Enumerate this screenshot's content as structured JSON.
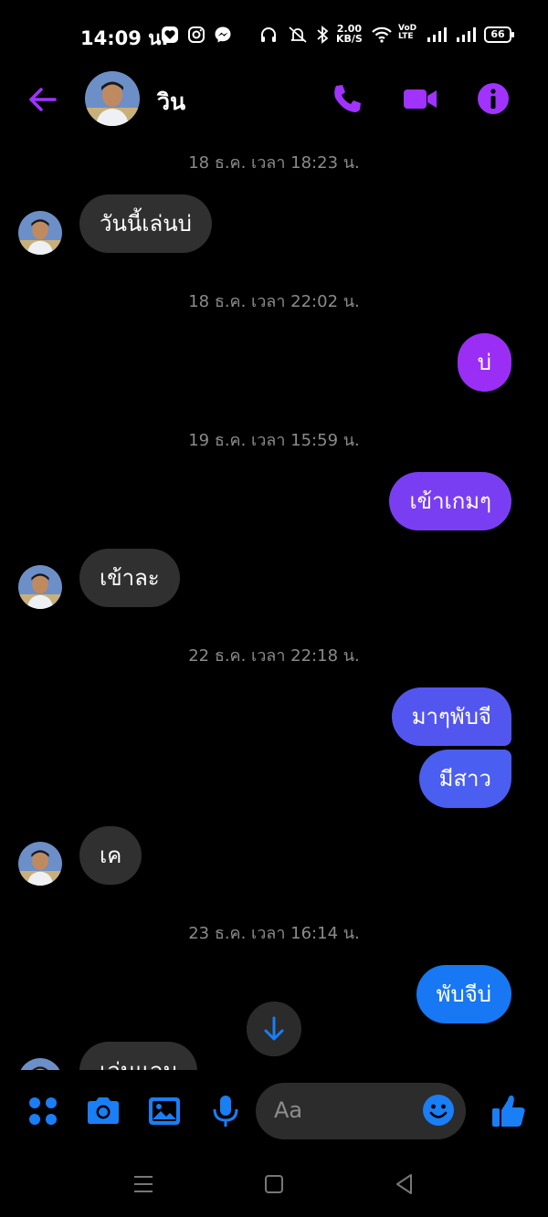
{
  "status": {
    "time": "14:09 น.",
    "speed_value": "2.00",
    "speed_unit": "KB/S",
    "volte_top": "VoD",
    "volte_bottom": "LTE",
    "battery": "66"
  },
  "header": {
    "contact_name": "วิน",
    "accent_color": "#a033ff"
  },
  "messages": [
    {
      "type": "timestamp",
      "text": "18 ธ.ค. เวลา 18:23 น."
    },
    {
      "type": "incoming",
      "text": "วันนี้เล่นบ่"
    },
    {
      "type": "timestamp",
      "text": "18 ธ.ค. เวลา 22:02 น."
    },
    {
      "type": "outgoing",
      "text": "บ่",
      "color": "#9a2ef5"
    },
    {
      "type": "timestamp",
      "text": "19 ธ.ค. เวลา 15:59 น."
    },
    {
      "type": "outgoing",
      "text": "เข้าเกมๆ",
      "color": "#7a3ef2"
    },
    {
      "type": "incoming",
      "text": "เข้าละ"
    },
    {
      "type": "timestamp",
      "text": "22 ธ.ค. เวลา 22:18 น."
    },
    {
      "type": "outgoing",
      "text": "มาๆพับจี",
      "color": "#5356ee"
    },
    {
      "type": "outgoing",
      "text": "มีสาว",
      "color": "#4a5ef0"
    },
    {
      "type": "incoming",
      "text": "เค"
    },
    {
      "type": "timestamp",
      "text": "23 ธ.ค. เวลา 16:14 น."
    },
    {
      "type": "outgoing",
      "text": "พับจีบ่",
      "color": "#1877f2"
    },
    {
      "type": "incoming",
      "text": "เล่นแลม"
    }
  ],
  "composer": {
    "placeholder": "Aa",
    "icon_color": "#1a7ef5"
  },
  "icons": {
    "back": "arrow-left-icon",
    "call": "phone-icon",
    "video": "video-camera-icon",
    "info": "info-icon",
    "apps": "four-dots-icon",
    "camera": "camera-icon",
    "gallery": "image-icon",
    "mic": "microphone-icon",
    "emoji": "smiley-icon",
    "like": "thumbs-up-icon",
    "scroll": "arrow-down-icon"
  }
}
